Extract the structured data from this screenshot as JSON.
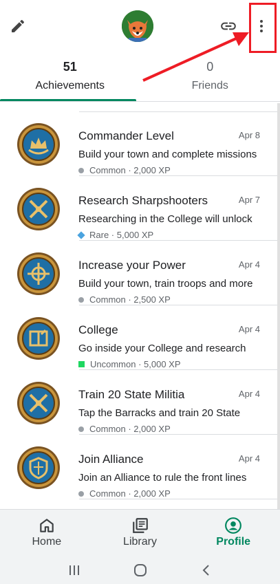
{
  "header": {
    "edit_icon": "pencil-icon",
    "link_icon": "link-icon",
    "more_icon": "more-vert-icon",
    "avatar": "fox-avatar"
  },
  "tabs": [
    {
      "count": "51",
      "label": "Achievements",
      "active": true
    },
    {
      "count": "0",
      "label": "Friends",
      "active": false
    }
  ],
  "achievements": [
    {
      "title": "Commander Level",
      "date": "Apr 8",
      "description": "Build your town and complete missions",
      "rarity": "Common",
      "rarity_marker": "dot",
      "xp": "2,000 XP",
      "meta": "Common · 2,000 XP"
    },
    {
      "title": "Research Sharpshooters",
      "date": "Apr 7",
      "description": "Researching in the College will unlock",
      "rarity": "Rare",
      "rarity_marker": "diamond",
      "xp": "5,000 XP",
      "meta": "Rare · 5,000 XP"
    },
    {
      "title": "Increase your Power",
      "date": "Apr 4",
      "description": "Build your town, train troops and more",
      "rarity": "Common",
      "rarity_marker": "dot",
      "xp": "2,500 XP",
      "meta": "Common · 2,500 XP"
    },
    {
      "title": "College",
      "date": "Apr 4",
      "description": "Go inside your College and research",
      "rarity": "Uncommon",
      "rarity_marker": "square",
      "xp": "5,000 XP",
      "meta": "Uncommon · 5,000 XP"
    },
    {
      "title": "Train 20 State Militia",
      "date": "Apr 4",
      "description": "Tap the Barracks and train 20 State",
      "rarity": "Common",
      "rarity_marker": "dot",
      "xp": "2,000 XP",
      "meta": "Common · 2,000 XP"
    },
    {
      "title": "Join Alliance",
      "date": "Apr 4",
      "description": "Join an Alliance to rule the front lines",
      "rarity": "Common",
      "rarity_marker": "dot",
      "xp": "2,000 XP",
      "meta": "Common · 2,000 XP"
    }
  ],
  "bottom_nav": [
    {
      "label": "Home",
      "icon": "home-icon",
      "active": false
    },
    {
      "label": "Library",
      "icon": "library-icon",
      "active": false
    },
    {
      "label": "Profile",
      "icon": "profile-icon",
      "active": true
    }
  ],
  "system_nav": [
    "recents-icon",
    "home-circle-icon",
    "back-icon"
  ],
  "colors": {
    "accent": "#01875f",
    "annotation": "#ee1c25"
  }
}
